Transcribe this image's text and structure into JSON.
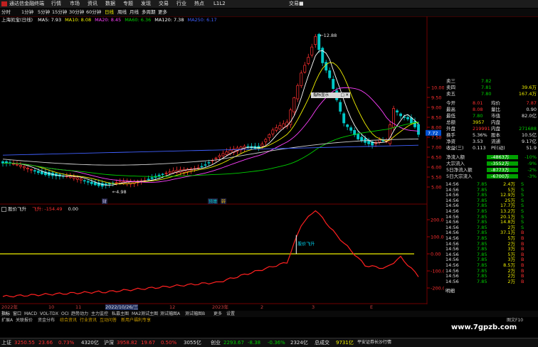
{
  "titlebar": {
    "app_name": "通达信金融终端",
    "menus": [
      "行情",
      "市场",
      "资讯",
      "数据",
      "专题",
      "发现",
      "交易",
      "行业",
      "热点"
    ],
    "code": "L1L2",
    "right": "交易■"
  },
  "toolbar": {
    "periods": [
      "分时",
      "1分钟",
      "5分钟",
      "15分钟",
      "30分钟",
      "60分钟",
      "日线",
      "周线",
      "月线",
      "多周期",
      "更多"
    ]
  },
  "chart": {
    "stock_label": "上海凯宝(日线)",
    "ma_items": [
      {
        "label": "MA5: 7.93",
        "color": "#ffffff"
      },
      {
        "label": "MA10: 8.08",
        "color": "#f0f000"
      },
      {
        "label": "MA20: 8.45",
        "color": "#ff40ff"
      },
      {
        "label": "MA60: 6.36",
        "color": "#00d000"
      },
      {
        "label": "MA120: 7.38",
        "color": "#ffffff"
      },
      {
        "label": "MA250: 6.17",
        "color": "#4060ff"
      }
    ],
    "high_label": "12.88",
    "low_label": "4.98",
    "markers": [
      "财",
      "预增",
      "转"
    ],
    "price_ticks": [
      "10.00",
      "9.50",
      "9.00",
      "8.50",
      "8.00",
      "7.50",
      "7.00",
      "6.50",
      "6.00",
      "5.50",
      "5.00"
    ],
    "current_price": "7.72",
    "popup_text": "指标显示"
  },
  "indicator": {
    "name": "股价飞升",
    "line_name": "飞升",
    "line_value": "-154.49",
    "zero_value": "0.00",
    "annotation": "股价飞升",
    "ticks": [
      "200.0",
      "100.0",
      "0.00",
      "-100.0",
      "-200.0"
    ]
  },
  "xaxis": {
    "labels": [
      "2022年",
      "10",
      "11",
      "2022/10/26/三",
      "12",
      "2023年",
      "2",
      "3",
      "E"
    ]
  },
  "quote_panel": {
    "rows": [
      {
        "label": "卖三",
        "value": "7.82",
        "value_color": "#00d000",
        "extra": "",
        "extra_color": "#f0f000"
      },
      {
        "label": "卖四",
        "value": "7.81",
        "value_color": "#00d000",
        "extra": "39.6万",
        "extra_color": "#f0f000"
      },
      {
        "label": "卖五",
        "value": "7.80",
        "value_color": "#00d000",
        "extra": "167.4万",
        "extra_color": "#f0f000"
      }
    ],
    "stats": [
      {
        "l1": "今开",
        "v1": "8.01",
        "v1c": "#ff3030",
        "l2": "均价",
        "v2": "7.87",
        "v2c": "#ff3030"
      },
      {
        "l1": "最高",
        "v1": "8.08",
        "v1c": "#ff3030",
        "l2": "量比",
        "v2": "0.90",
        "v2c": "#e8e8e8"
      },
      {
        "l1": "最低",
        "v1": "7.80",
        "v1c": "#00d000",
        "l2": "市值",
        "v2": "82.0亿",
        "v2c": "#e8e8e8"
      },
      {
        "l1": "总额",
        "v1": "3957",
        "v1c": "#f0f000",
        "l2": "内盘",
        "v2": "",
        "v2c": "#e8e8e8"
      },
      {
        "l1": "外盘",
        "v1": "219991",
        "v1c": "#ff3030",
        "l2": "内盘",
        "v2": "271688",
        "v2c": "#00d000"
      },
      {
        "l1": "换手",
        "v1": "5.36%",
        "v1c": "#e8e8e8",
        "l2": "股本",
        "v2": "10.5亿",
        "v2c": "#e8e8e8"
      },
      {
        "l1": "净资",
        "v1": "3.53",
        "v1c": "#e8e8e8",
        "l2": "流通",
        "v2": "9.17亿",
        "v2c": "#e8e8e8"
      },
      {
        "l1": "收益(三)",
        "v1": "0.113",
        "v1c": "#e8e8e8",
        "l2": "PE(动)",
        "v2": "51.9",
        "v2c": "#e8e8e8"
      }
    ],
    "flows": [
      {
        "label": "净流入额",
        "value": "-4863万",
        "pct": "-10%"
      },
      {
        "label": "大宗流入",
        "value": "-3552万",
        "pct": "-9%"
      },
      {
        "label": "5日净流入额",
        "value": "-8773万",
        "pct": "-2%"
      },
      {
        "label": "5日大宗流入",
        "value": "-6700万",
        "pct": "-3%"
      }
    ],
    "ticks": [
      {
        "time": "14:56",
        "price": "7.85",
        "vol": "2.4万",
        "side": "S"
      },
      {
        "time": "14:56",
        "price": "7.85",
        "vol": "5万",
        "side": "S"
      },
      {
        "time": "14:56",
        "price": "7.85",
        "vol": "12.9万",
        "side": "S"
      },
      {
        "time": "14:56",
        "price": "7.85",
        "vol": "25万",
        "side": "S"
      },
      {
        "time": "14:56",
        "price": "7.85",
        "vol": "17.7万",
        "side": "S"
      },
      {
        "time": "14:56",
        "price": "7.85",
        "vol": "13.2万",
        "side": "S"
      },
      {
        "time": "14:56",
        "price": "7.85",
        "vol": "20.1万",
        "side": "S"
      },
      {
        "time": "14:56",
        "price": "7.85",
        "vol": "14.8万",
        "side": "S"
      },
      {
        "time": "14:56",
        "price": "7.85",
        "vol": "2万",
        "side": "S"
      },
      {
        "time": "14:56",
        "price": "7.85",
        "vol": "37.1万",
        "side": "B"
      },
      {
        "time": "14:56",
        "price": "7.85",
        "vol": "5万",
        "side": "B"
      },
      {
        "time": "14:56",
        "price": "7.85",
        "vol": "2万",
        "side": "B"
      },
      {
        "time": "14:56",
        "price": "7.85",
        "vol": "3万",
        "side": "B"
      },
      {
        "time": "14:56",
        "price": "7.85",
        "vol": "5万",
        "side": "B"
      },
      {
        "time": "14:56",
        "price": "7.85",
        "vol": "3万",
        "side": "B"
      },
      {
        "time": "14:56",
        "price": "7.85",
        "vol": "8.5万",
        "side": "B"
      },
      {
        "time": "14:56",
        "price": "7.85",
        "vol": "2万",
        "side": "B"
      },
      {
        "time": "14:56",
        "price": "7.85",
        "vol": "2万",
        "side": "B"
      },
      {
        "time": "14:56",
        "price": "7.85",
        "vol": "2万",
        "side": "B"
      }
    ],
    "bottom_tab": "明细"
  },
  "tabs": {
    "row1": [
      "指标",
      "窗口",
      "MACD",
      "VOL-TDX",
      "OCI",
      "趋势动力",
      "主力监控",
      "私募主图",
      "MA2",
      "测试主图",
      "测试幅图A",
      "测试幅图B",
      "更多",
      "设置"
    ],
    "row2": [
      "扩展A",
      "关联报价",
      "资金分布",
      "综合资讯",
      "行业资讯",
      "互动问答",
      "新用户福利专享"
    ],
    "right_tab": "图文F10"
  },
  "statusbar": {
    "items": [
      {
        "name": "上证",
        "v": "3250.55",
        "c": "23.66",
        "p": "0.73%",
        "amt": "4320亿"
      },
      {
        "name": "沪深",
        "v": "3958.82",
        "c": "19.67",
        "p": "0.50%",
        "amt": "3055亿"
      },
      {
        "name": "创业",
        "v": "2293.67",
        "c": "-8.38",
        "p": "-0.36%",
        "amt": "2324亿"
      }
    ],
    "total_label": "总成交",
    "total": "9731亿",
    "broker": "平安证券长沙行情"
  },
  "watermark": "www.7gpzb.com",
  "colors": {
    "up": "#ff3030",
    "down": "#00d000",
    "bg": "#000000",
    "axis": "#700000"
  }
}
